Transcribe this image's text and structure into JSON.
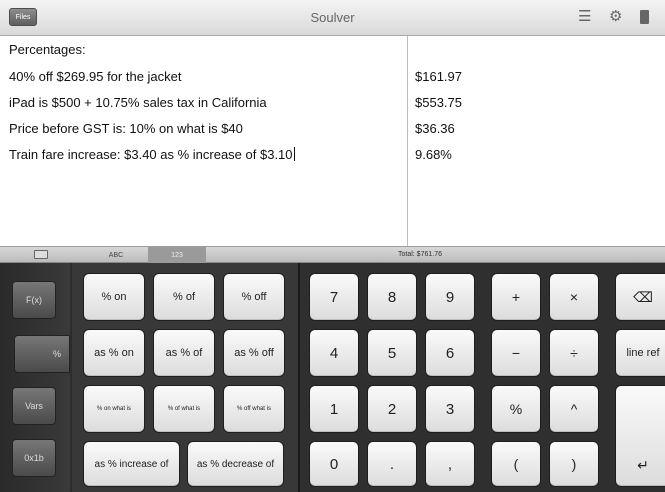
{
  "titlebar": {
    "files_label": "Files",
    "title": "Soulver",
    "icons": [
      "menu-icon",
      "gear-icon",
      "book-icon"
    ]
  },
  "editor": {
    "lines": [
      "Percentages:",
      "40% off $269.95 for the jacket",
      "iPad is $500 + 10.75% sales tax in California",
      "Price before GST is: 10% on what is $40",
      "Train fare increase: $3.40 as % increase of $3.10"
    ],
    "answers": [
      "",
      "$161.97",
      "$553.75",
      "$36.36",
      "9.68%"
    ]
  },
  "keyboard_bar": {
    "toggle_icon": "keyboard-icon",
    "tabs": [
      "ABC",
      "123"
    ],
    "active_tab": "123",
    "total": "Total: $761.76"
  },
  "side_keys": [
    "F(x)",
    "%",
    "Vars",
    "0x1b"
  ],
  "percent_keys": {
    "row1": [
      "% on",
      "% of",
      "% off"
    ],
    "row2": [
      "as % on",
      "as % of",
      "as % off"
    ],
    "row3": [
      "% on what is",
      "% of what is",
      "% off what is"
    ],
    "row4": [
      "as % increase of",
      "as % decrease of"
    ]
  },
  "number_keys": {
    "row1": [
      "7",
      "8",
      "9",
      "+",
      "×",
      "⌫"
    ],
    "row2": [
      "4",
      "5",
      "6",
      "−",
      "÷",
      "line ref"
    ],
    "row3": [
      "1",
      "2",
      "3",
      "%",
      "^"
    ],
    "row4": [
      "0",
      ".",
      ",",
      "(",
      ")",
      "↵"
    ]
  }
}
